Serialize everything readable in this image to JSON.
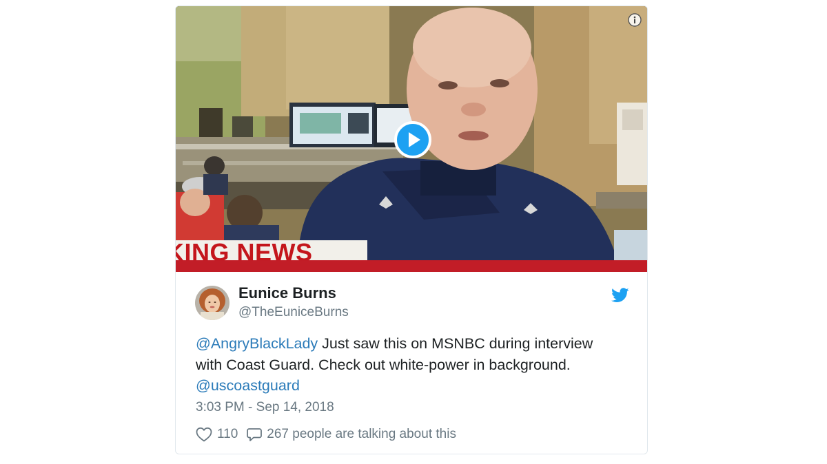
{
  "video": {
    "banner_text": "KING NEWS",
    "colors": {
      "banner_red": "#c4161c",
      "play_blue": "#1da1f2"
    }
  },
  "icons": {
    "info": "info-icon",
    "play": "play-icon",
    "twitter": "twitter-bird-icon",
    "like": "heart-icon",
    "reply": "speech-bubble-icon"
  },
  "tweet": {
    "display_name": "Eunice Burns",
    "handle": "@TheEuniceBurns",
    "mention_1": "@AngryBlackLady",
    "text_body": " Just saw this on MSNBC during interview with Coast Guard. Check out white-power in background. ",
    "mention_2": "@uscoastguard",
    "timestamp": "3:03 PM - Sep 14, 2018",
    "like_count": "110",
    "talk_text": "267 people are talking about this"
  },
  "colors": {
    "link": "#2b7bb9",
    "text": "#1c2022",
    "muted": "#697882",
    "twitter_blue": "#1da1f2"
  }
}
